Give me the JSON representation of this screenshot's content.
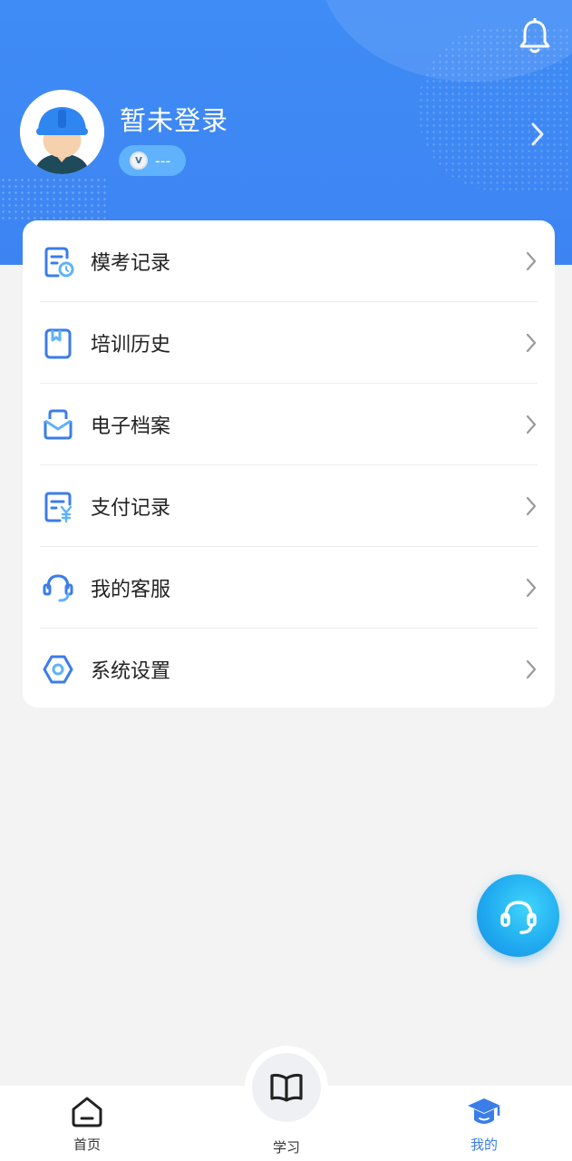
{
  "colors": {
    "header_bg": "#3f8cf6",
    "accent": "#3b7de9",
    "page_bg": "#f3f3f3",
    "fab": "#1ea8ef"
  },
  "header": {
    "bell_icon": "bell-icon",
    "username": "暂未登录",
    "badge_icon": "coin-icon",
    "badge_icon_glyph": "V",
    "badge_value": "---",
    "arrow_icon": "chevron-right-icon"
  },
  "menu": {
    "items": [
      {
        "label": "模考记录",
        "icon": "exam-record-icon"
      },
      {
        "label": "培训历史",
        "icon": "training-history-icon"
      },
      {
        "label": "电子档案",
        "icon": "e-archive-icon"
      },
      {
        "label": "支付记录",
        "icon": "payment-record-icon"
      },
      {
        "label": "我的客服",
        "icon": "customer-service-icon"
      },
      {
        "label": "系统设置",
        "icon": "settings-icon"
      }
    ]
  },
  "fab": {
    "icon": "headset-icon"
  },
  "tabbar": {
    "tabs": [
      {
        "label": "首页",
        "icon": "home-icon",
        "active": false
      },
      {
        "label": "学习",
        "icon": "book-icon",
        "active": false
      },
      {
        "label": "我的",
        "icon": "graduation-cap-icon",
        "active": true
      }
    ]
  }
}
